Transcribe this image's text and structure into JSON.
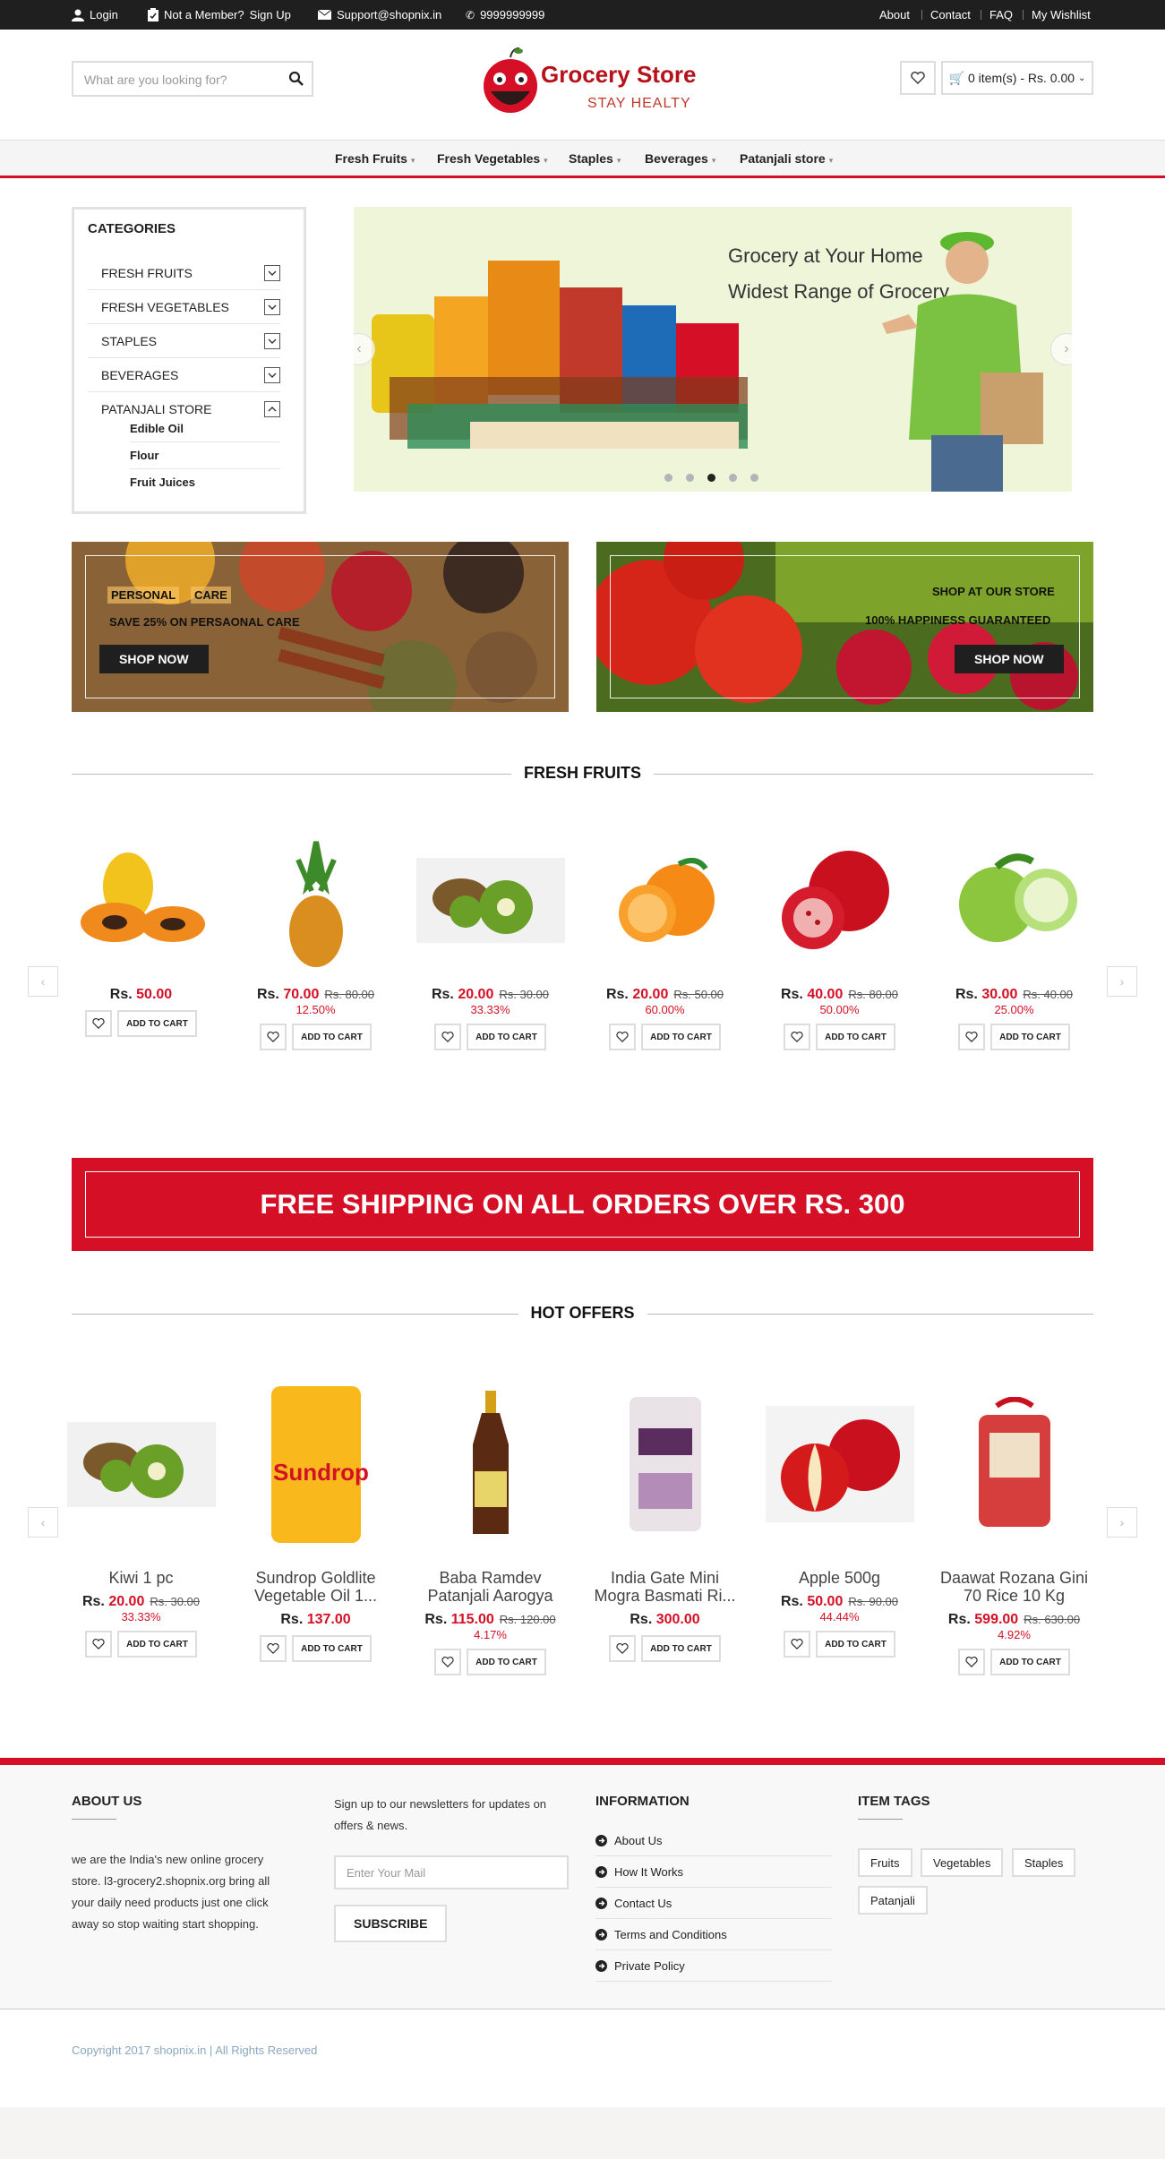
{
  "topbar": {
    "login": "Login",
    "not_member": "Not a Member?",
    "sign_up": "Sign Up",
    "support": "Support@shopnix.in",
    "phone": "9999999999",
    "links": [
      "About",
      "Contact",
      "FAQ",
      "My Wishlist"
    ]
  },
  "header": {
    "search_placeholder": "What are you looking for?",
    "logo_title": "Grocery Store",
    "logo_tagline": "STAY HEALTY",
    "cart_label": "0 item(s) - Rs. 0.00"
  },
  "nav": [
    "Fresh Fruits",
    "Fresh Vegetables",
    "Staples",
    "Beverages",
    "Patanjali store"
  ],
  "categories": {
    "title": "CATEGORIES",
    "items": [
      "FRESH FRUITS",
      "FRESH VEGETABLES",
      "STAPLES",
      "BEVERAGES",
      "PATANJALI STORE"
    ],
    "sub_items": [
      "Edible Oil",
      "Flour",
      "Fruit Juices"
    ]
  },
  "slider": {
    "line1": "Grocery at Your Home",
    "line2": "Widest Range of Grocery",
    "active_dot": 3,
    "dot_count": 5
  },
  "banners": [
    {
      "line1a": "PERSONAL",
      "line1b": "CARE",
      "line2": "SAVE 25% ON PERSAONAL CARE",
      "button": "SHOP NOW"
    },
    {
      "line1": "SHOP AT OUR STORE",
      "line2": "100% HAPPINESS GUARANTEED",
      "button": "SHOP NOW"
    }
  ],
  "fresh_fruits": {
    "title": "FRESH FRUITS",
    "products": [
      {
        "price": "50.00",
        "old": "",
        "disc": ""
      },
      {
        "price": "70.00",
        "old": "Rs. 80.00",
        "disc": "12.50%"
      },
      {
        "price": "20.00",
        "old": "Rs. 30.00",
        "disc": "33.33%"
      },
      {
        "price": "20.00",
        "old": "Rs. 50.00",
        "disc": "60.00%"
      },
      {
        "price": "40.00",
        "old": "Rs. 80.00",
        "disc": "50.00%"
      },
      {
        "price": "30.00",
        "old": "Rs. 40.00",
        "disc": "25.00%"
      }
    ]
  },
  "add_to_cart": "ADD TO CART",
  "currency": "Rs.",
  "shipping_banner": "FREE SHIPPING ON ALL ORDERS OVER RS. 300",
  "hot_offers": {
    "title": "HOT OFFERS",
    "products": [
      {
        "name": "Kiwi 1 pc",
        "price": "20.00",
        "old": "Rs. 30.00",
        "disc": "33.33%"
      },
      {
        "name": "Sundrop Goldlite Vegetable Oil 1...",
        "price": "137.00",
        "old": "",
        "disc": ""
      },
      {
        "name": "Baba Ramdev Patanjali Aarogya",
        "price": "115.00",
        "old": "Rs. 120.00",
        "disc": "4.17%"
      },
      {
        "name": "India Gate Mini Mogra Basmati Ri...",
        "price": "300.00",
        "old": "",
        "disc": ""
      },
      {
        "name": "Apple 500g",
        "price": "50.00",
        "old": "Rs. 90.00",
        "disc": "44.44%"
      },
      {
        "name": "Daawat Rozana Gini 70 Rice 10 Kg",
        "price": "599.00",
        "old": "Rs. 630.00",
        "disc": "4.92%"
      }
    ]
  },
  "footer": {
    "about_title": "ABOUT US",
    "about_text": "we are the India's new online grocery store. l3-grocery2.shopnix.org bring all your daily need products just one click away so stop waiting start shopping.",
    "newsletter_text": "Sign up to our newsletters for updates on offers & news.",
    "email_placeholder": "Enter Your Mail",
    "subscribe": "SUBSCRIBE",
    "info_title": "INFORMATION",
    "info_links": [
      "About Us",
      "How It Works",
      "Contact Us",
      "Terms and Conditions",
      "Private Policy"
    ],
    "tags_title": "ITEM TAGS",
    "tags": [
      "Fruits",
      "Vegetables",
      "Staples",
      "Patanjali"
    ],
    "copyright": "Copyright 2017 shopnix.in | All Rights Reserved"
  },
  "colors": {
    "accent": "#d50f25",
    "dark": "#1f1f1f"
  }
}
